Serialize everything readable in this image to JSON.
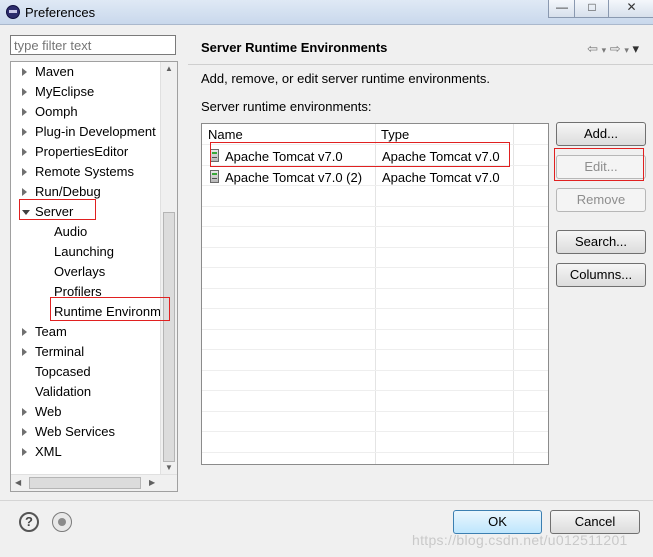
{
  "window": {
    "title": "Preferences",
    "controls": {
      "minimize": "—",
      "maximize": "□",
      "close": "✕"
    }
  },
  "sidebar": {
    "filter_placeholder": "type filter text",
    "items": [
      {
        "label": "Maven",
        "level": 0,
        "expander": "closed"
      },
      {
        "label": "MyEclipse",
        "level": 0,
        "expander": "closed"
      },
      {
        "label": "Oomph",
        "level": 0,
        "expander": "closed"
      },
      {
        "label": "Plug-in Development",
        "level": 0,
        "expander": "closed"
      },
      {
        "label": "PropertiesEditor",
        "level": 0,
        "expander": "closed"
      },
      {
        "label": "Remote Systems",
        "level": 0,
        "expander": "closed"
      },
      {
        "label": "Run/Debug",
        "level": 0,
        "expander": "closed"
      },
      {
        "label": "Server",
        "level": 0,
        "expander": "open"
      },
      {
        "label": "Audio",
        "level": 1,
        "expander": "none"
      },
      {
        "label": "Launching",
        "level": 1,
        "expander": "none"
      },
      {
        "label": "Overlays",
        "level": 1,
        "expander": "none"
      },
      {
        "label": "Profilers",
        "level": 1,
        "expander": "none"
      },
      {
        "label": "Runtime Environm",
        "level": 1,
        "expander": "none",
        "selected": true
      },
      {
        "label": "Team",
        "level": 0,
        "expander": "closed"
      },
      {
        "label": "Terminal",
        "level": 0,
        "expander": "closed"
      },
      {
        "label": "Topcased",
        "level": 0,
        "expander": "none"
      },
      {
        "label": "Validation",
        "level": 0,
        "expander": "none"
      },
      {
        "label": "Web",
        "level": 0,
        "expander": "closed"
      },
      {
        "label": "Web Services",
        "level": 0,
        "expander": "closed"
      },
      {
        "label": "XML",
        "level": 0,
        "expander": "closed"
      }
    ]
  },
  "main": {
    "title": "Server Runtime Environments",
    "nav_icons": {
      "back": "⇦",
      "forward": "⇨",
      "menu": "▾"
    },
    "description": "Add, remove, or edit server runtime environments.",
    "list_label": "Server runtime environments:",
    "table": {
      "columns": [
        "Name",
        "Type"
      ],
      "rows": [
        {
          "name": "Apache Tomcat v7.0",
          "type": "Apache Tomcat v7.0",
          "icon": "server-icon"
        },
        {
          "name": "Apache Tomcat v7.0 (2)",
          "type": "Apache Tomcat v7.0",
          "icon": "server-icon"
        }
      ]
    },
    "buttons": {
      "add": "Add...",
      "edit": "Edit...",
      "remove": "Remove",
      "search": "Search...",
      "columns": "Columns..."
    }
  },
  "footer": {
    "help_icon": "?",
    "ok": "OK",
    "cancel": "Cancel"
  },
  "watermark": "https://blog.csdn.net/u012511201",
  "colors": {
    "highlight_box": "#e02020",
    "ok_button_border": "#3c7fb1"
  }
}
